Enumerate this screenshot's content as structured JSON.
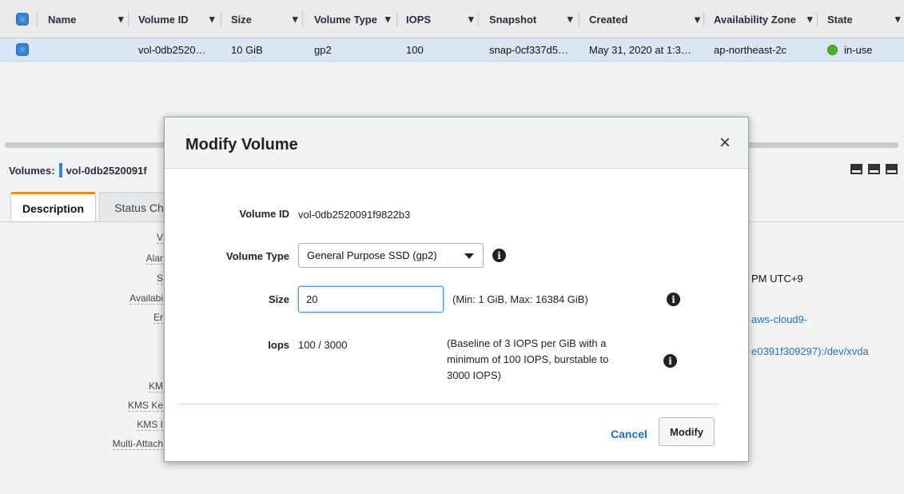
{
  "table": {
    "columns": [
      "Name",
      "Volume ID",
      "Size",
      "Volume Type",
      "IOPS",
      "Snapshot",
      "Created",
      "Availability Zone",
      "State"
    ],
    "row": {
      "name": "",
      "volume_id": "vol-0db2520…",
      "size": "10 GiB",
      "volume_type": "gp2",
      "iops": "100",
      "snapshot": "snap-0cf337d5…",
      "created": "May 31, 2020 at 1:3…",
      "availability_zone": "ap-northeast-2c",
      "state": "in-use"
    }
  },
  "details": {
    "title_prefix": "Volumes:",
    "title_volume": "vol-0db2520091f",
    "tabs": [
      "Description",
      "Status Ch"
    ],
    "labels": [
      "V",
      "Alar",
      "S",
      "Availabi",
      "Er",
      "KM",
      "KMS Ke",
      "KMS I",
      "Multi-Attach"
    ],
    "values": [
      "PM UTC+9",
      "aws-cloud9-",
      "e0391f309297):/dev/xvda"
    ]
  },
  "modal": {
    "title": "Modify Volume",
    "close": "×",
    "volume_id_label": "Volume ID",
    "volume_id_value": "vol-0db2520091f9822b3",
    "volume_type_label": "Volume Type",
    "volume_type_value": "General Purpose SSD (gp2)",
    "size_label": "Size",
    "size_value": "20",
    "size_note": "(Min: 1 GiB, Max: 16384 GiB)",
    "iops_label": "Iops",
    "iops_value": "100 / 3000",
    "iops_note_lines": [
      "(Baseline of 3 IOPS per GiB with a",
      "minimum of 100 IOPS, burstable to",
      "3000 IOPS)"
    ],
    "cancel": "Cancel",
    "modify": "Modify"
  },
  "colors": {
    "accent": "#3b82d6",
    "link": "#1a73c7",
    "tab_active": "#e88a1a",
    "status_green": "#4cae2f"
  },
  "icons": [
    "checkbox-icon",
    "sort-caret-icon",
    "status-dot-icon",
    "info-icon",
    "close-icon",
    "dropdown-caret-icon",
    "layout-icons"
  ]
}
